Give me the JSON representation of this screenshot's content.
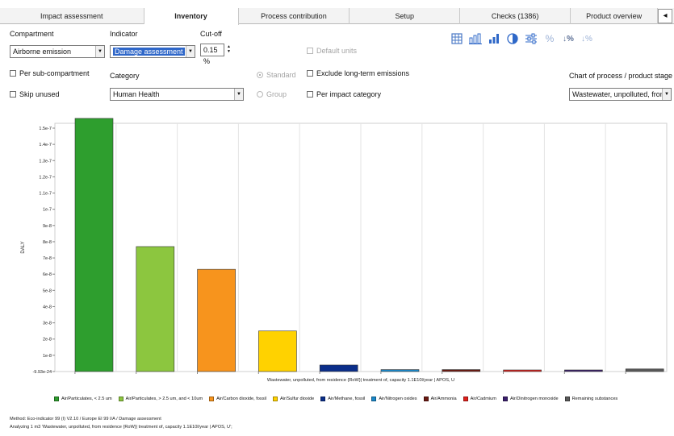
{
  "tabs": [
    {
      "label": "Impact assessment",
      "width": 180,
      "active": false
    },
    {
      "label": "Inventory",
      "width": 118,
      "active": true
    },
    {
      "label": "Process contribution",
      "width": 139,
      "active": false
    },
    {
      "label": "Setup",
      "width": 138,
      "active": false
    },
    {
      "label": "Checks (1386)",
      "width": 138,
      "active": false
    },
    {
      "label": "Product overview",
      "width": 109,
      "active": false
    }
  ],
  "tab_nav_icon": "◂",
  "compartment": {
    "label": "Compartment",
    "value": "Airborne emission"
  },
  "indicator": {
    "label": "Indicator",
    "value": "Damage assessment"
  },
  "cutoff": {
    "label": "Cut-off",
    "value": "0.15 %"
  },
  "default_units": "Default units",
  "per_sub_compartment": "Per sub-compartment",
  "skip_unused": "Skip unused",
  "category": {
    "label": "Category",
    "value": "Human Health"
  },
  "standard": "Standard",
  "group": "Group",
  "exclude_long_term": "Exclude long-term emissions",
  "per_impact_category": "Per impact category",
  "chart_of_process": {
    "label": "Chart of process / product stage",
    "value": "Wastewater, unpolluted, from residenc"
  },
  "toolbar_icons": [
    "table-icon",
    "bar-chart-icon",
    "bar-chart-sorted-icon",
    "pie-chart-icon",
    "sliders-icon",
    "percent-icon",
    "sort-percent-icon",
    "sort-percent-alt-icon"
  ],
  "chart_data": {
    "type": "bar",
    "ylabel": "DALY",
    "xlabel": "Wastewater, unpolluted, from residence {RoW}| treatment of, capacity 1.1E10l/year | APOS, U",
    "ymin_label": "-9.93e-24",
    "ylim": [
      0,
      1.5e-07
    ],
    "yticks": [
      {
        "v": 1.5e-07,
        "label": "1.5e-7"
      },
      {
        "v": 1.4e-07,
        "label": "1.4e-7"
      },
      {
        "v": 1.3e-07,
        "label": "1.3e-7"
      },
      {
        "v": 1.2e-07,
        "label": "1.2e-7"
      },
      {
        "v": 1.1e-07,
        "label": "1.1e-7"
      },
      {
        "v": 1e-07,
        "label": "1e-7"
      },
      {
        "v": 9e-08,
        "label": "9e-8"
      },
      {
        "v": 8e-08,
        "label": "8e-8"
      },
      {
        "v": 7e-08,
        "label": "7e-8"
      },
      {
        "v": 6e-08,
        "label": "6e-8"
      },
      {
        "v": 5e-08,
        "label": "5e-8"
      },
      {
        "v": 4e-08,
        "label": "4e-8"
      },
      {
        "v": 3e-08,
        "label": "3e-8"
      },
      {
        "v": 2e-08,
        "label": "2e-8"
      },
      {
        "v": 1e-08,
        "label": "1e-8"
      },
      {
        "v": 0,
        "label": "-9.93e-24"
      }
    ],
    "series": [
      {
        "name": "Air/Particulates, < 2.5 um",
        "value": 1.56e-07,
        "color": "#2e9e2e"
      },
      {
        "name": "Air/Particulates, > 2.5 um, and < 10um",
        "value": 7.7e-08,
        "color": "#8cc63f"
      },
      {
        "name": "Air/Carbon dioxide, fossil",
        "value": 6.3e-08,
        "color": "#f7941d"
      },
      {
        "name": "Air/Sulfur dioxide",
        "value": 2.5e-08,
        "color": "#ffd200"
      },
      {
        "name": "Air/Methane, fossil",
        "value": 4e-09,
        "color": "#0b2e8a"
      },
      {
        "name": "Air/Nitrogen oxides",
        "value": 1.2e-09,
        "color": "#1a88c9"
      },
      {
        "name": "Air/Ammonia",
        "value": 1.2e-09,
        "color": "#6b1a12"
      },
      {
        "name": "Air/Cadmium",
        "value": 6e-10,
        "color": "#e0201b"
      },
      {
        "name": "Air/Dinitrogen monoxide",
        "value": 8e-10,
        "color": "#3b1f6e"
      },
      {
        "name": "Remaining substances",
        "value": 1.6e-09,
        "color": "#5a5a5a"
      }
    ]
  },
  "method_line": "Method: Eco-indicator 99 (I) V2.10 / Europe EI 99 I/A / Damage assessment",
  "analyzing_line": "Analyzing 1 m3 'Wastewater, unpolluted, from residence {RoW}| treatment of, capacity 1.1E10l/year | APOS, U';"
}
